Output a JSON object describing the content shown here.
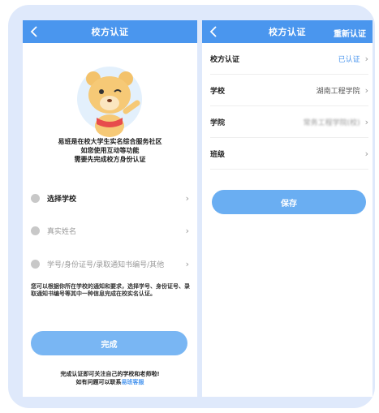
{
  "left": {
    "nav_title": "校方认证",
    "intro_lines": [
      "易班是在校大学生实名综合服务社区",
      "如您使用互动等功能",
      "需要先完成校方身份认证"
    ],
    "fields": {
      "school": "选择学校",
      "name": "真实姓名",
      "id": "学号/身份证号/录取通知书编号/其他"
    },
    "hint": "您可以根据你所在学校的通知和要求，选择学号、身份证号、录取通知书编号等其中一种信息完成在校实名认证。",
    "done_label": "完成",
    "footer_line1": "完成认证即可关注自己的学校和老师啦!",
    "footer_line2_prefix": "如有问题可以联系",
    "footer_link": "易班客服"
  },
  "right": {
    "nav_title": "校方认证",
    "nav_action": "重新认证",
    "rows": [
      {
        "key": "校方认证",
        "value": "已认证"
      },
      {
        "key": "学校",
        "value": "湖南工程学院"
      },
      {
        "key": "学院",
        "value": "常务工程学院(校)"
      },
      {
        "key": "班级",
        "value": ""
      }
    ],
    "save_label": "保存"
  },
  "colors": {
    "brand": "#4a96ee",
    "button": "#79b6f3",
    "frame": "#dfe9fb"
  },
  "icons": [
    "back-arrow-icon",
    "mascot-bear-icon",
    "school-icon",
    "person-icon",
    "id-card-icon",
    "chevron-right-icon"
  ]
}
